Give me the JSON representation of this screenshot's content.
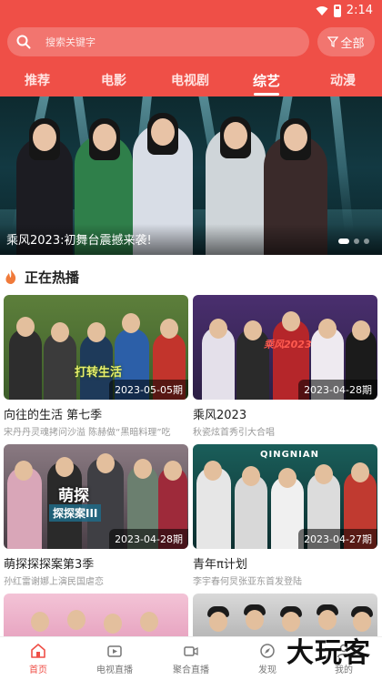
{
  "status": {
    "time": "2:14"
  },
  "search": {
    "placeholder": "搜索关键字",
    "filter_label": "全部"
  },
  "tabs": [
    {
      "label": "推荐"
    },
    {
      "label": "电影"
    },
    {
      "label": "电视剧"
    },
    {
      "label": "综艺",
      "active": true
    },
    {
      "label": "动漫"
    }
  ],
  "banner": {
    "caption": "乘风2023:初舞台震撼来袭!"
  },
  "section": {
    "title": "正在热播"
  },
  "cards": [
    {
      "title": "向往的生活 第七季",
      "subtitle": "宋丹丹灵魂拷问沙溢 陈赫做“黑暗料理”吃",
      "episode": "2023-05-05期"
    },
    {
      "title": "乘风2023",
      "subtitle": "秋瓷炫首秀引大合唱",
      "episode": "2023-04-28期"
    },
    {
      "title": "萌探探探案第3季",
      "subtitle": "孙红雷谢娜上演民国虐恋",
      "episode": "2023-04-28期"
    },
    {
      "title": "青年π计划",
      "subtitle": "李宇春何炅张亚东首发登陆",
      "episode": "2023-04-27期"
    }
  ],
  "thumb_text": {
    "card1": "打转生活",
    "card2": "乘风2023",
    "card3a": "萌探",
    "card3b": "探探案III",
    "card4": "QINGNIAN"
  },
  "bottom_nav": [
    {
      "label": "首页",
      "active": true,
      "icon": "home-icon"
    },
    {
      "label": "电视直播",
      "icon": "tv-icon"
    },
    {
      "label": "聚合直播",
      "icon": "video-icon"
    },
    {
      "label": "发现",
      "icon": "compass-icon"
    },
    {
      "label": "我的",
      "icon": "user-icon"
    }
  ],
  "watermark": "大玩客",
  "colors": {
    "accent": "#ef4f47"
  }
}
